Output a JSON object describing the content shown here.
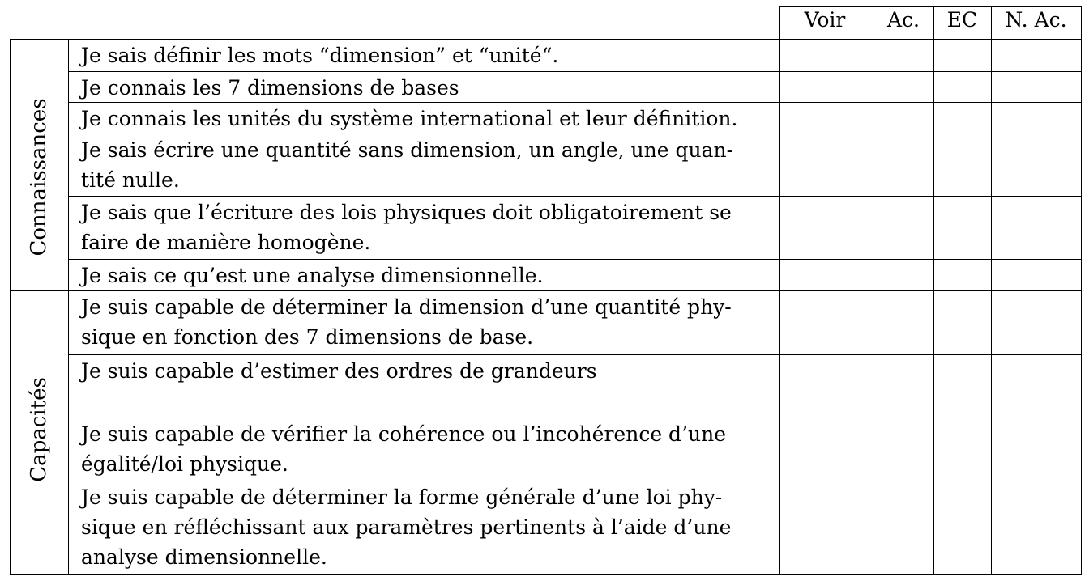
{
  "columns": {
    "voir": "Voir",
    "acquis": "Ac.",
    "en_cours": "EC",
    "non_acquis": "N. Ac."
  },
  "sections": [
    {
      "label": "Connaissances",
      "items": [
        "Je sais définir les mots “dimension” et “unité“.",
        "Je connais les 7 dimensions de bases",
        "Je connais les unités du système international et leur définition.",
        "Je sais écrire une quantité sans dimension, un angle, une quan-\ntité nulle.",
        "Je sais que l’écriture des lois physiques doit obligatoirement se\nfaire de manière homogène.",
        "Je sais ce qu’est une analyse dimensionnelle."
      ]
    },
    {
      "label": "Capacités",
      "items": [
        "Je suis capable de déterminer la dimension d’une quantité phy-\nsique en fonction des 7 dimensions de base.",
        "Je suis capable d’estimer des ordres de grandeurs",
        "Je suis capable de vérifier la cohérence ou l’incohérence d’une\négalité/loi physique.",
        "Je suis capable de déterminer la forme générale d’une loi phy-\nsique en réfléchissant aux paramètres pertinents à l’aide d’une\nanalyse dimensionnelle."
      ]
    }
  ]
}
